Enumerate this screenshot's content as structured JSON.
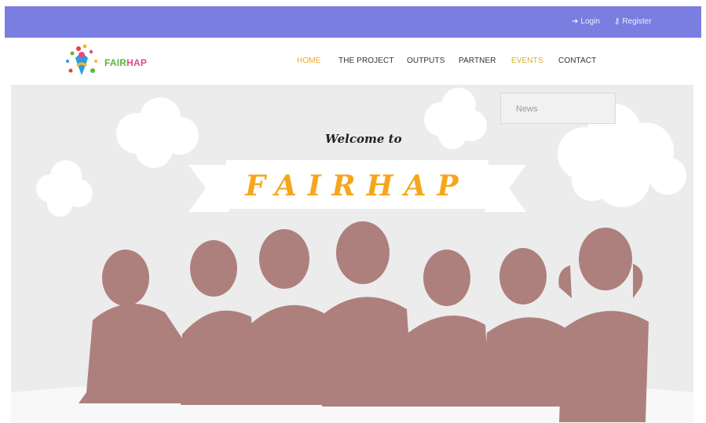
{
  "topbar": {
    "login_label": "Login",
    "register_label": "Register"
  },
  "brand": {
    "logo_text_part1": "FAIR",
    "logo_text_part2": "HAP"
  },
  "nav": {
    "items": [
      {
        "label": "HOME",
        "active": true
      },
      {
        "label": "THE PROJECT"
      },
      {
        "label": "OUTPUTS"
      },
      {
        "label": "PARTNER"
      },
      {
        "label": "EVENTS"
      },
      {
        "label": "CONTACT"
      }
    ]
  },
  "news": {
    "label": "News"
  },
  "hero": {
    "welcome_text": "Welcome to",
    "title": "FAIRHAP"
  },
  "colors": {
    "topbar": "#7a7ee0",
    "accent_orange": "#f6a61c",
    "hero_background": "#ececec",
    "silhouette": "#ad807d"
  }
}
